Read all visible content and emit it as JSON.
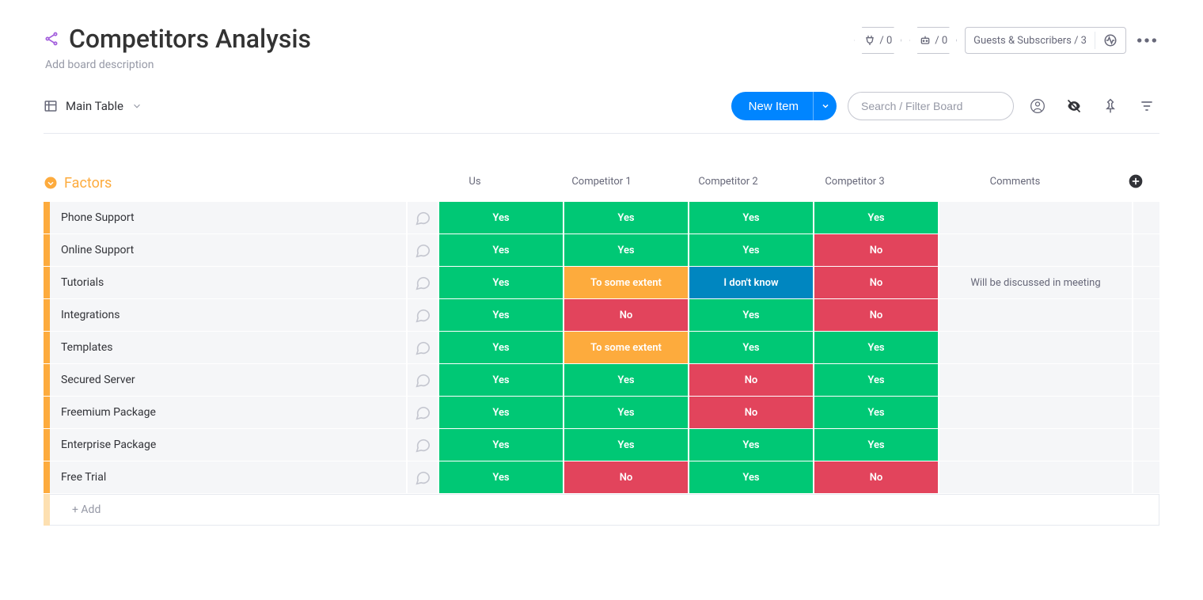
{
  "header": {
    "title": "Competitors Analysis",
    "description_placeholder": "Add board description",
    "guests_label": "Guests & Subscribers / 3",
    "badge_integrations": "/ 0",
    "badge_automations": "/ 0"
  },
  "toolbar": {
    "view_label": "Main Table",
    "new_item_label": "New Item",
    "search_placeholder": "Search / Filter Board"
  },
  "group": {
    "title": "Factors",
    "add_row_label": "+ Add",
    "columns": [
      "Us",
      "Competitor 1",
      "Competitor 2",
      "Competitor 3",
      "Comments"
    ]
  },
  "status_labels": {
    "yes": "Yes",
    "no": "No",
    "some": "To some extent",
    "idk": "I don't know"
  },
  "rows": [
    {
      "name": "Phone Support",
      "cells": [
        "yes",
        "yes",
        "yes",
        "yes"
      ],
      "comment": ""
    },
    {
      "name": "Online Support",
      "cells": [
        "yes",
        "yes",
        "yes",
        "no"
      ],
      "comment": ""
    },
    {
      "name": "Tutorials",
      "cells": [
        "yes",
        "some",
        "idk",
        "no"
      ],
      "comment": "Will be discussed in meeting"
    },
    {
      "name": "Integrations",
      "cells": [
        "yes",
        "no",
        "yes",
        "no"
      ],
      "comment": ""
    },
    {
      "name": "Templates",
      "cells": [
        "yes",
        "some",
        "yes",
        "yes"
      ],
      "comment": ""
    },
    {
      "name": "Secured Server",
      "cells": [
        "yes",
        "yes",
        "no",
        "yes"
      ],
      "comment": ""
    },
    {
      "name": "Freemium Package",
      "cells": [
        "yes",
        "yes",
        "no",
        "yes"
      ],
      "comment": ""
    },
    {
      "name": "Enterprise Package",
      "cells": [
        "yes",
        "yes",
        "yes",
        "yes"
      ],
      "comment": ""
    },
    {
      "name": "Free Trial",
      "cells": [
        "yes",
        "no",
        "yes",
        "no"
      ],
      "comment": ""
    }
  ]
}
